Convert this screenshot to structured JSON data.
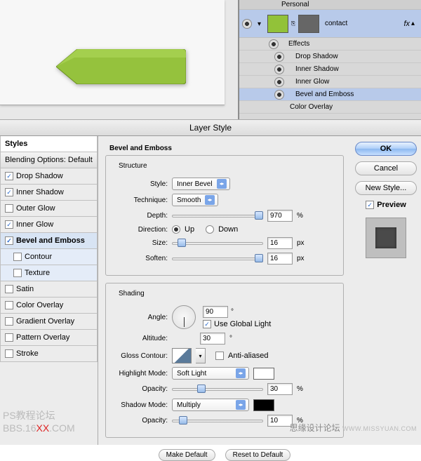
{
  "layers": {
    "group": "Personal",
    "name": "contact",
    "fx": "fx",
    "effects_label": "Effects",
    "effects": [
      "Drop Shadow",
      "Inner Shadow",
      "Inner Glow",
      "Bevel and Emboss",
      "Color Overlay"
    ]
  },
  "dialog": {
    "title": "Layer Style",
    "sidebar": {
      "styles": "Styles",
      "blending": "Blending Options: Default",
      "items": [
        {
          "label": "Drop Shadow",
          "checked": true
        },
        {
          "label": "Inner Shadow",
          "checked": true
        },
        {
          "label": "Outer Glow",
          "checked": false
        },
        {
          "label": "Inner Glow",
          "checked": true
        },
        {
          "label": "Bevel and Emboss",
          "checked": true,
          "active": true
        },
        {
          "label": "Contour",
          "checked": false,
          "sub": true
        },
        {
          "label": "Texture",
          "checked": false,
          "sub": true
        },
        {
          "label": "Satin",
          "checked": false
        },
        {
          "label": "Color Overlay",
          "checked": false
        },
        {
          "label": "Gradient Overlay",
          "checked": false
        },
        {
          "label": "Pattern Overlay",
          "checked": false
        },
        {
          "label": "Stroke",
          "checked": false
        }
      ]
    },
    "bevel": {
      "heading": "Bevel and Emboss",
      "structure_title": "Structure",
      "style_label": "Style:",
      "style_value": "Inner Bevel",
      "technique_label": "Technique:",
      "technique_value": "Smooth",
      "depth_label": "Depth:",
      "depth_value": "970",
      "depth_unit": "%",
      "direction_label": "Direction:",
      "up": "Up",
      "down": "Down",
      "size_label": "Size:",
      "size_value": "16",
      "size_unit": "px",
      "soften_label": "Soften:",
      "soften_value": "16",
      "soften_unit": "px",
      "shading_title": "Shading",
      "angle_label": "Angle:",
      "angle_value": "90",
      "angle_unit": "°",
      "global_light": "Use Global Light",
      "altitude_label": "Altitude:",
      "altitude_value": "30",
      "altitude_unit": "°",
      "gloss_label": "Gloss Contour:",
      "antialiased": "Anti-aliased",
      "highlight_label": "Highlight Mode:",
      "highlight_value": "Soft Light",
      "highlight_color": "#ffffff",
      "h_opacity_label": "Opacity:",
      "h_opacity_value": "30",
      "h_opacity_unit": "%",
      "shadow_label": "Shadow Mode:",
      "shadow_value": "Multiply",
      "shadow_color": "#000000",
      "s_opacity_label": "Opacity:",
      "s_opacity_value": "10",
      "s_opacity_unit": "%",
      "make_default": "Make Default",
      "reset_default": "Reset to Default"
    },
    "buttons": {
      "ok": "OK",
      "cancel": "Cancel",
      "new_style": "New Style...",
      "preview": "Preview"
    }
  },
  "watermark": {
    "left_a": "PS教程论坛",
    "left_b1": "BBS.16",
    "left_b2": "XX",
    "left_b3": ".COM",
    "right": "思缘设计论坛",
    "right_url": "WWW.MISSYUAN.COM"
  }
}
